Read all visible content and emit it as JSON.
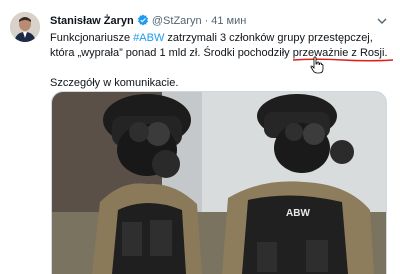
{
  "tweet": {
    "author_name": "Stanisław Żaryn",
    "verified": true,
    "handle": "@StZaryn",
    "separator": "·",
    "time": "41 мин",
    "line1_before": "Funkcjonariusze ",
    "hashtag": "#ABW",
    "line1_after": " zatrzymali 3 członków grupy przestępczej, która „wyprała” ponad 1 mld zł. Środki pochodziły ",
    "emphasis": "przeważnie z Rosji",
    "line1_end": ".",
    "line2": "Szczegóły w komunikacie.",
    "media": {
      "vest_label": "ABW"
    }
  },
  "colors": {
    "link": "#1d9bf0",
    "annotation": "#e0201b",
    "verified": "#1d9bf0"
  }
}
